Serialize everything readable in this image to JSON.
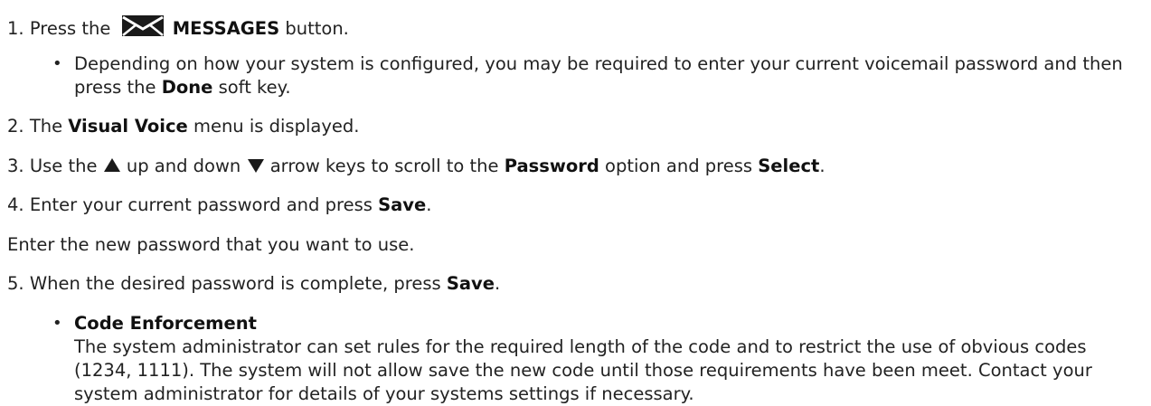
{
  "steps": {
    "step1": {
      "num": "1.",
      "pre": "Press the",
      "icon": "envelope-icon",
      "bold": "MESSAGES",
      "post": "button."
    },
    "bullet1": {
      "pre": "Depending on how your system is configured, you may be required to enter your current voicemail password and then press the",
      "bold": "Done",
      "post": "soft key."
    },
    "step2": {
      "num": "2.",
      "pre": "The",
      "bold": "Visual Voice",
      "post": "menu is displayed."
    },
    "step3": {
      "num": "3.",
      "pre": "Use the",
      "icon_up": "up-arrow-icon",
      "mid1": "up and down",
      "icon_down": "down-arrow-icon",
      "mid2": "arrow keys to scroll to the",
      "bold1": "Password",
      "mid3": "option and press",
      "bold2": "Select",
      "post": "."
    },
    "step4": {
      "num": "4.",
      "pre": "Enter your current password and press",
      "bold": "Save",
      "post": "."
    },
    "plain": "Enter the new password that you want to use.",
    "step5": {
      "num": "5.",
      "pre": "When the desired password is complete, press",
      "bold": "Save",
      "post": "."
    },
    "bullet2": {
      "title": "Code Enforcement",
      "body": "The system administrator can set rules for the required length of the code and to restrict the use of obvious codes (1234, 1111). The system will not allow save the new code until those requirements have been meet. Contact your system administrator for details of your systems settings if necessary."
    }
  }
}
